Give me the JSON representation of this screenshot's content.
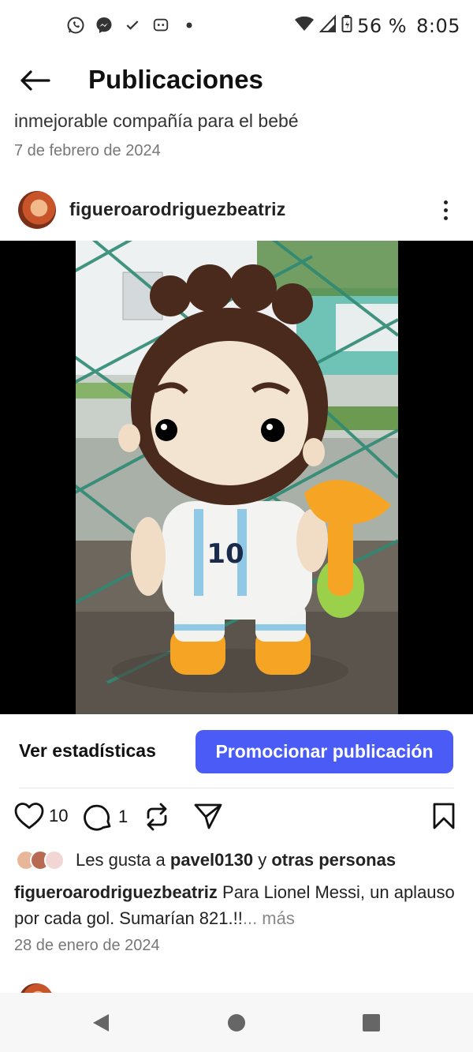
{
  "status_bar": {
    "battery": "56 %",
    "time": "8:05",
    "icons": [
      "whatsapp-icon",
      "messenger-icon",
      "check-icon",
      "chat-bubble-icon",
      "dot-icon",
      "wifi-icon",
      "signal-icon",
      "battery-icon"
    ]
  },
  "header": {
    "title": "Publicaciones"
  },
  "previous_post": {
    "caption": "inmejorable compañía para el bebé",
    "date": "7 de febrero de 2024"
  },
  "post": {
    "username": "figueroarodriguezbeatriz",
    "stats_label": "Ver estadísticas",
    "promote_label": "Promocionar publicación",
    "likes_count": "10",
    "comments_count": "1",
    "likes_prefix": "Les gusta a",
    "likes_user": "pavel0130",
    "likes_and": "y",
    "likes_others": "otras personas",
    "caption_user": "figueroarodriguezbeatriz",
    "caption_text": "Para Lionel Messi, un aplauso por cada gol. Sumarían 821.!!",
    "caption_more": "... más",
    "date": "28 de enero de 2024",
    "jersey_number": "10"
  },
  "colors": {
    "accent": "#4a5cf5",
    "text": "#111111",
    "muted": "#777777"
  }
}
